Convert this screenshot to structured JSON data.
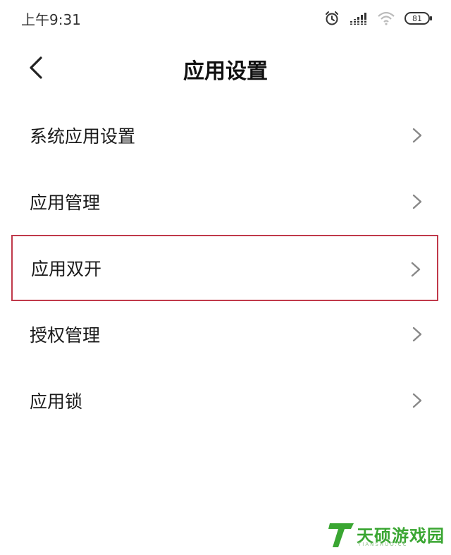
{
  "status_bar": {
    "time": "上午9:31",
    "battery": "81",
    "icons": [
      "alarm-icon",
      "signal-icon",
      "wifi-icon",
      "battery-icon"
    ]
  },
  "header": {
    "title": "应用设置",
    "back_icon": "chevron-left-icon"
  },
  "menu": {
    "items": [
      {
        "label": "系统应用设置"
      },
      {
        "label": "应用管理"
      },
      {
        "label": "应用双开",
        "highlighted": true
      },
      {
        "label": "授权管理"
      },
      {
        "label": "应用锁"
      }
    ],
    "chevron_icon": "chevron-right-icon"
  },
  "watermark": {
    "text": "天硕游戏园",
    "subtext": "TIANSHUO.CC"
  },
  "colors": {
    "background": "#ffffff",
    "highlight_border": "#c0394a",
    "watermark_green": "#3aa632"
  }
}
